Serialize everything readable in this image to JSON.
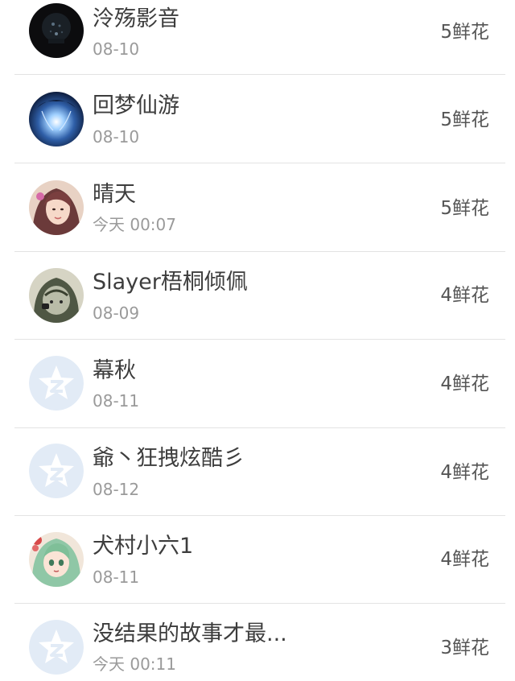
{
  "flower_list": {
    "rows": [
      {
        "name": "泠殇影音",
        "date": "08-10",
        "flowers": "5鲜花",
        "avatar": "dark-avatar"
      },
      {
        "name": "回梦仙游",
        "date": "08-10",
        "flowers": "5鲜花",
        "avatar": "blue-light-avatar"
      },
      {
        "name": "晴天",
        "date": "今天 00:07",
        "flowers": "5鲜花",
        "avatar": "girl-photo-avatar"
      },
      {
        "name": "Slayer梧桐倾佩",
        "date": "08-09",
        "flowers": "4鲜花",
        "avatar": "hooded-figure-avatar"
      },
      {
        "name": "幕秋",
        "date": "08-11",
        "flowers": "4鲜花",
        "avatar": "default-qzone-avatar"
      },
      {
        "name": "爺丶狂拽炫酷彡",
        "date": "08-12",
        "flowers": "4鲜花",
        "avatar": "default-qzone-avatar"
      },
      {
        "name": "犬村小六1",
        "date": "08-11",
        "flowers": "4鲜花",
        "avatar": "anime-girl-avatar"
      },
      {
        "name": "没结果的故事才最...",
        "date": "今天 00:11",
        "flowers": "3鲜花",
        "avatar": "default-qzone-avatar"
      }
    ]
  },
  "colors": {
    "name_text": "#3d3d3d",
    "date_text": "#9a9a9a",
    "flower_text": "#555555",
    "divider": "#e3e3e3",
    "default_avatar_bg": "#e2ebf6"
  }
}
